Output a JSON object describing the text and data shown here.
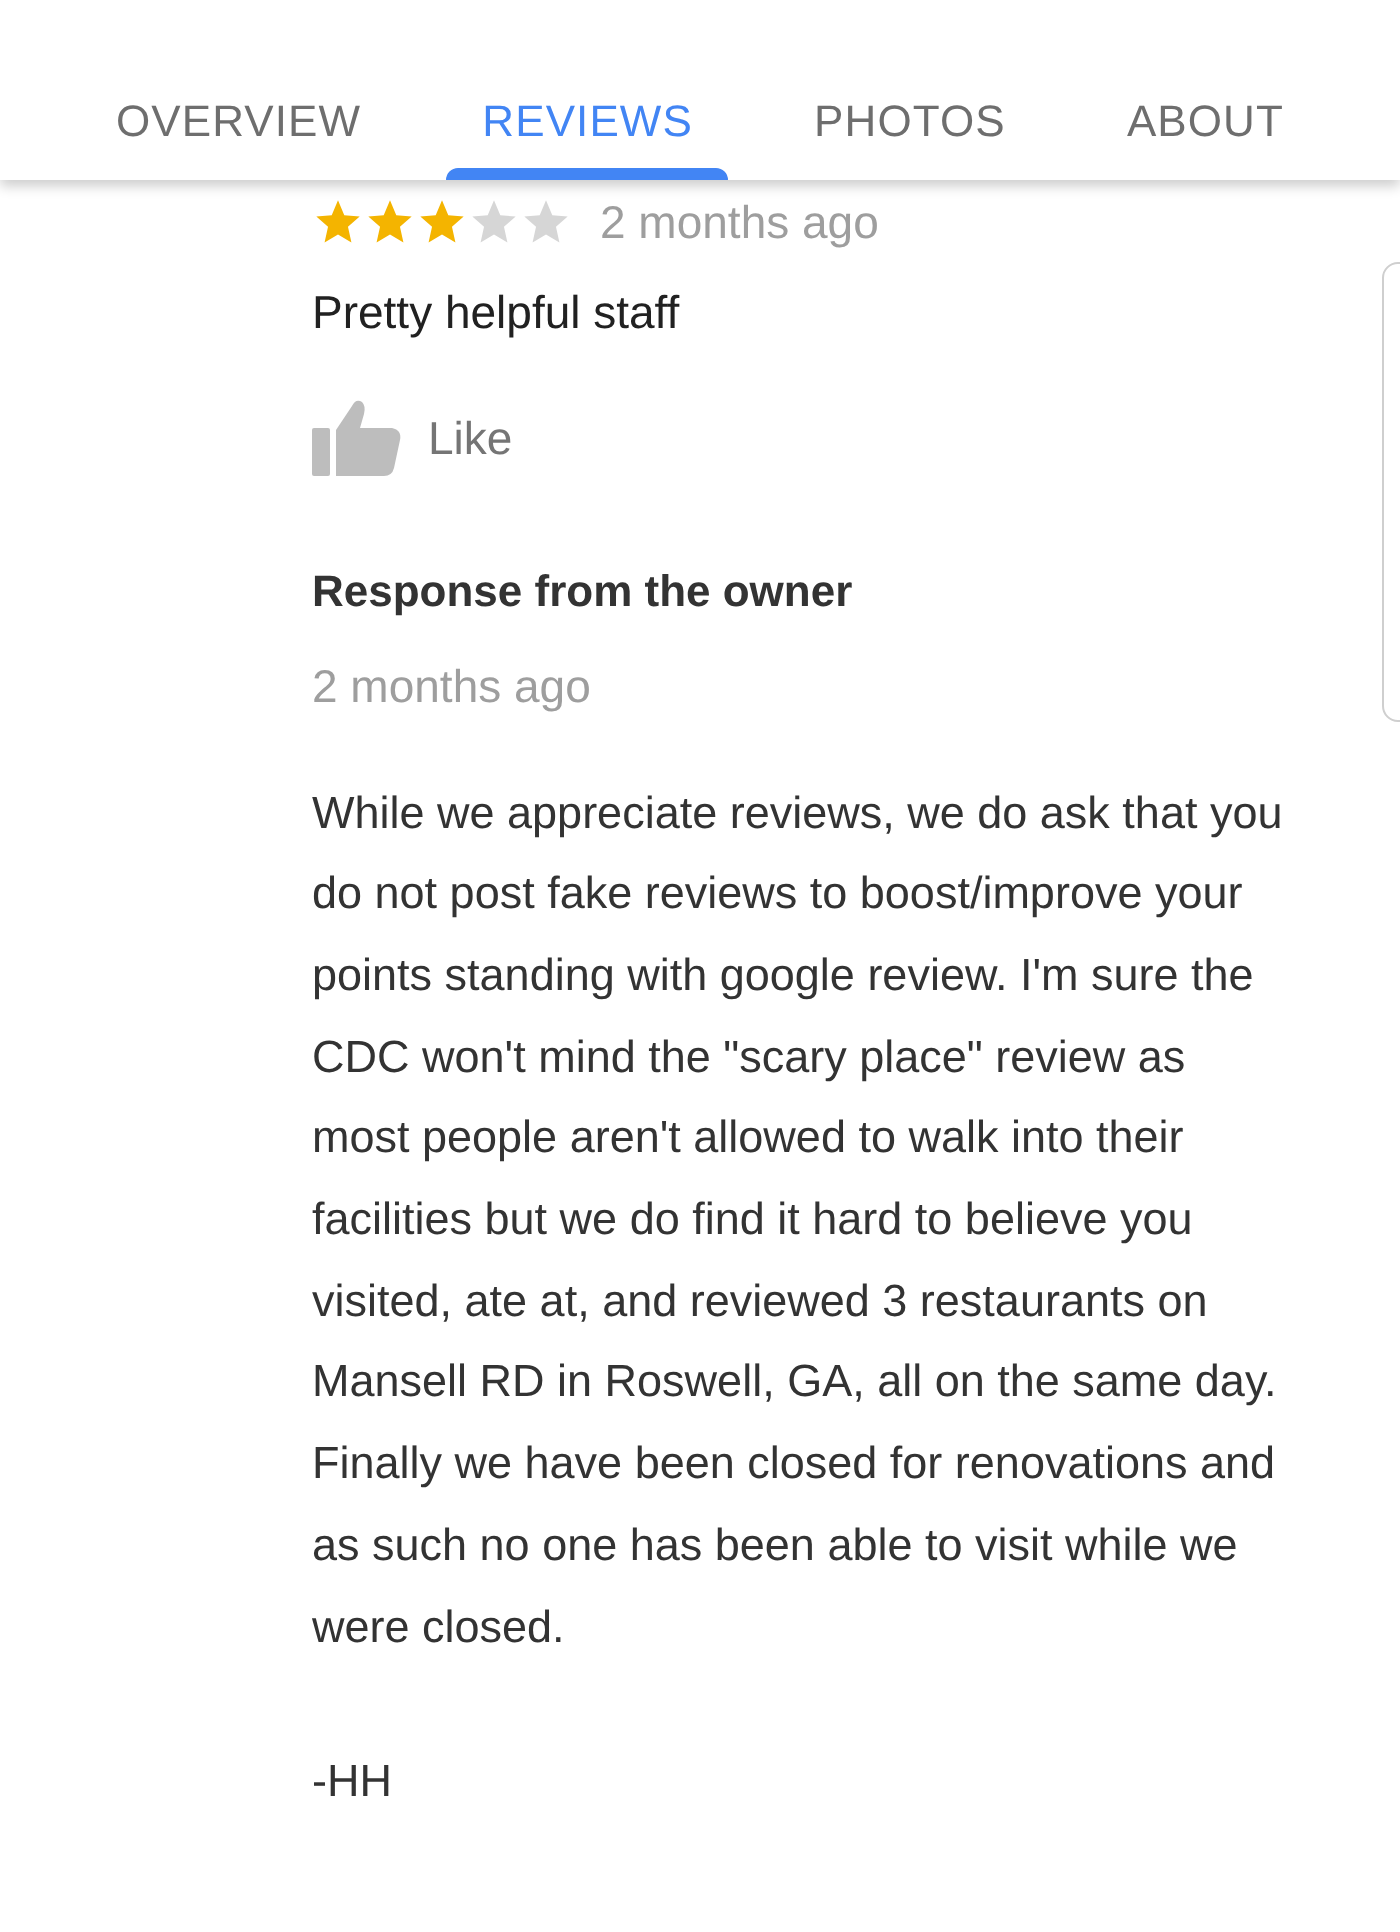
{
  "tabs": [
    {
      "label": "OVERVIEW",
      "selected": false
    },
    {
      "label": "REVIEWS",
      "selected": true
    },
    {
      "label": "PHOTOS",
      "selected": false
    },
    {
      "label": "ABOUT",
      "selected": false
    }
  ],
  "review": {
    "stars": 3,
    "time": "2 months ago",
    "text": "Pretty helpful staff",
    "like_label": "Like"
  },
  "owner_response": {
    "title": "Response from the owner",
    "time": "2 months ago",
    "text": "While we appreciate reviews, we do ask that you do not post fake reviews to boost/improve your points standing with google review. I'm sure the CDC won't mind the \"scary place\" review as most people aren't allowed to walk into their facilities but we do find it hard to believe you visited, ate at, and reviewed 3 restaurants on Mansell RD in Roswell, GA, all on the same day. Finally we have been closed for renovations and as such no one has been able to visit while we were closed.",
    "signature": "-HH"
  }
}
